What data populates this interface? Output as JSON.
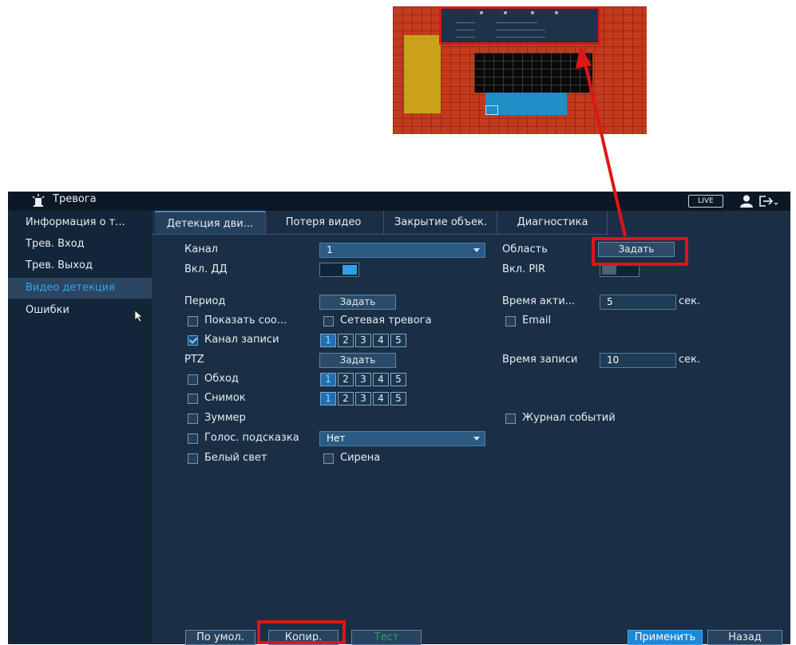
{
  "window": {
    "title": "Тревога",
    "live_badge": "LIVE"
  },
  "sidebar": {
    "items": [
      {
        "label": "Информация о т..."
      },
      {
        "label": "Трев. Вход"
      },
      {
        "label": "Трев. Выход"
      },
      {
        "label": "Видео детекция",
        "active": true
      },
      {
        "label": "Ошибки"
      }
    ]
  },
  "tabs": [
    {
      "label": "Детекция дви...",
      "active": true
    },
    {
      "label": "Потеря видео"
    },
    {
      "label": "Закрытие объек."
    },
    {
      "label": "Диагностика"
    }
  ],
  "form": {
    "channel_label": "Канал",
    "channel_value": "1",
    "enable_label": "Вкл. ДД",
    "enable_on": true,
    "area_label": "Область",
    "area_button": "Задать",
    "pir_label": "Вкл. PIR",
    "pir_on": false,
    "period_label": "Период",
    "period_button": "Задать",
    "activation_label": "Время акти...",
    "activation_value": "5",
    "activation_unit": "сек.",
    "show_message_label": "Показать соо...",
    "show_message_checked": false,
    "net_alarm_label": "Сетевая тревога",
    "net_alarm_checked": false,
    "email_label": "Email",
    "email_checked": false,
    "record_channel_label": "Канал записи",
    "record_channel_checked": true,
    "record_channels": [
      "1",
      "2",
      "3",
      "4",
      "5"
    ],
    "ptz_label": "PTZ",
    "ptz_button": "Задать",
    "record_time_label": "Время записи",
    "record_time_value": "10",
    "record_time_unit": "сек.",
    "tour_label": "Обход",
    "tour_checked": false,
    "tour_channels": [
      "1",
      "2",
      "3",
      "4",
      "5"
    ],
    "snapshot_label": "Снимок",
    "snapshot_checked": false,
    "snapshot_channels": [
      "1",
      "2",
      "3",
      "4",
      "5"
    ],
    "buzzer_label": "Зуммер",
    "buzzer_checked": false,
    "event_log_label": "Журнал событий",
    "event_log_checked": false,
    "voice_label": "Голос. подсказка",
    "voice_checked": false,
    "voice_value": "Нет",
    "white_light_label": "Белый свет",
    "white_light_checked": false,
    "siren_label": "Сирена",
    "siren_checked": false
  },
  "footer": {
    "default_button": "По умол.",
    "copy_button": "Копир.",
    "test_button": "Тест",
    "apply_button": "Применить",
    "back_button": "Назад"
  },
  "colors": {
    "highlight": "#e01515",
    "accent": "#2fa6ee",
    "background": "#1a2f45"
  }
}
